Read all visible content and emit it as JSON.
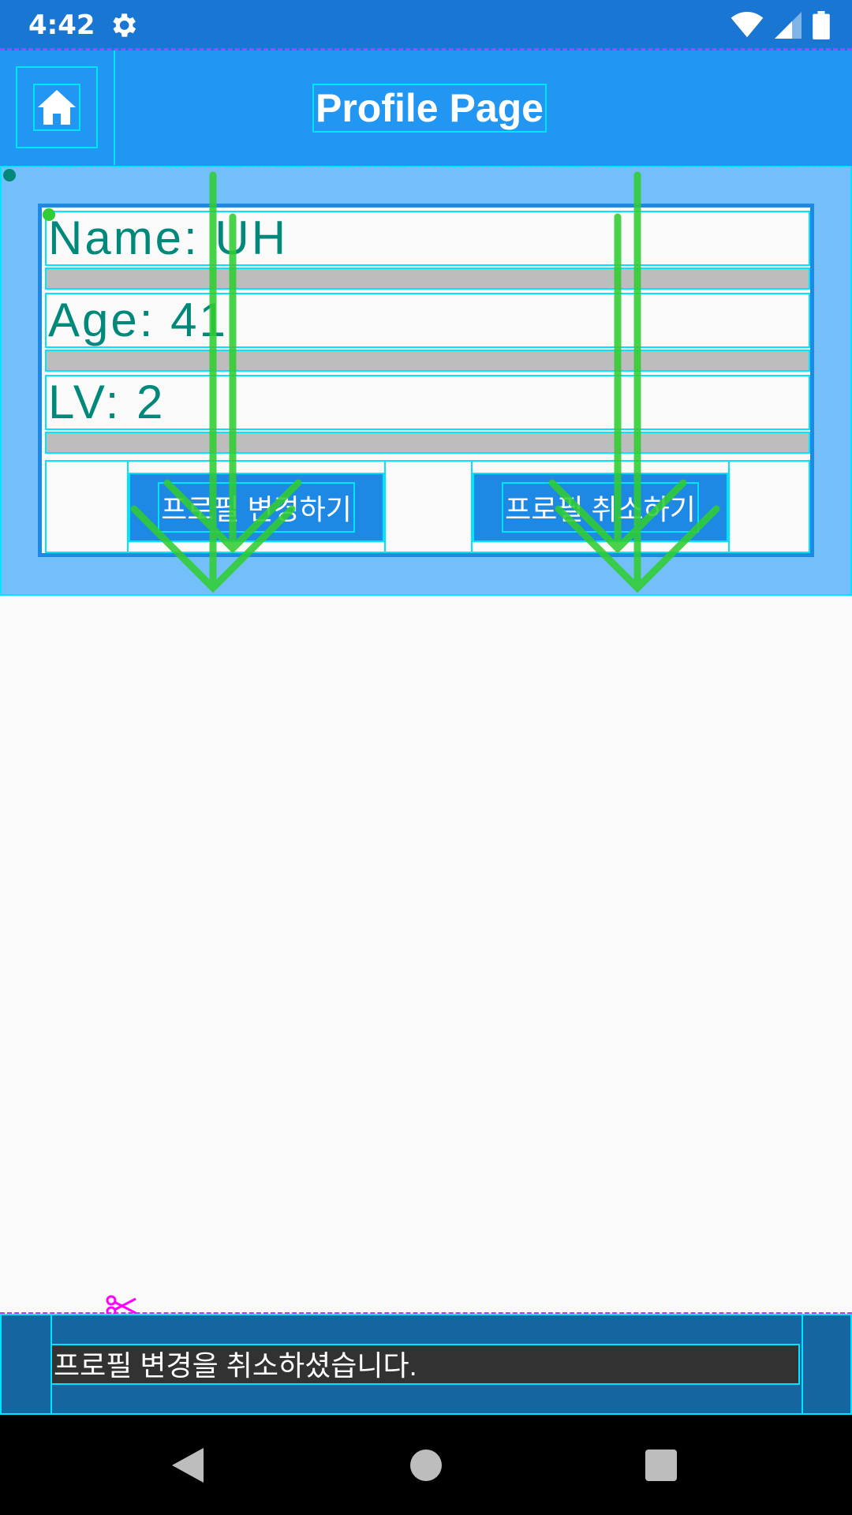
{
  "status_bar": {
    "time": "4:42",
    "icons": [
      "gear-icon",
      "wifi-icon",
      "signal-icon",
      "battery-icon"
    ]
  },
  "app_bar": {
    "title": "Profile Page",
    "home_icon": "home-icon"
  },
  "profile": {
    "name": "Name: UH",
    "age": "Age: 41",
    "level": "LV: 2"
  },
  "buttons": {
    "change_label": "프로필 변경하기",
    "cancel_label": "프로필 취소하기"
  },
  "snackbar": {
    "message": "프로필 변경을 취소하셨습니다."
  },
  "nav_bar": {
    "icons": [
      "back-icon",
      "home-circle-icon",
      "recents-icon"
    ]
  },
  "colors": {
    "primary": "#2196f3",
    "primary_dark": "#1976d2",
    "accent_text": "#00897b",
    "debug_outline": "#00e5ff",
    "overlay_arrow": "#32cd32"
  }
}
